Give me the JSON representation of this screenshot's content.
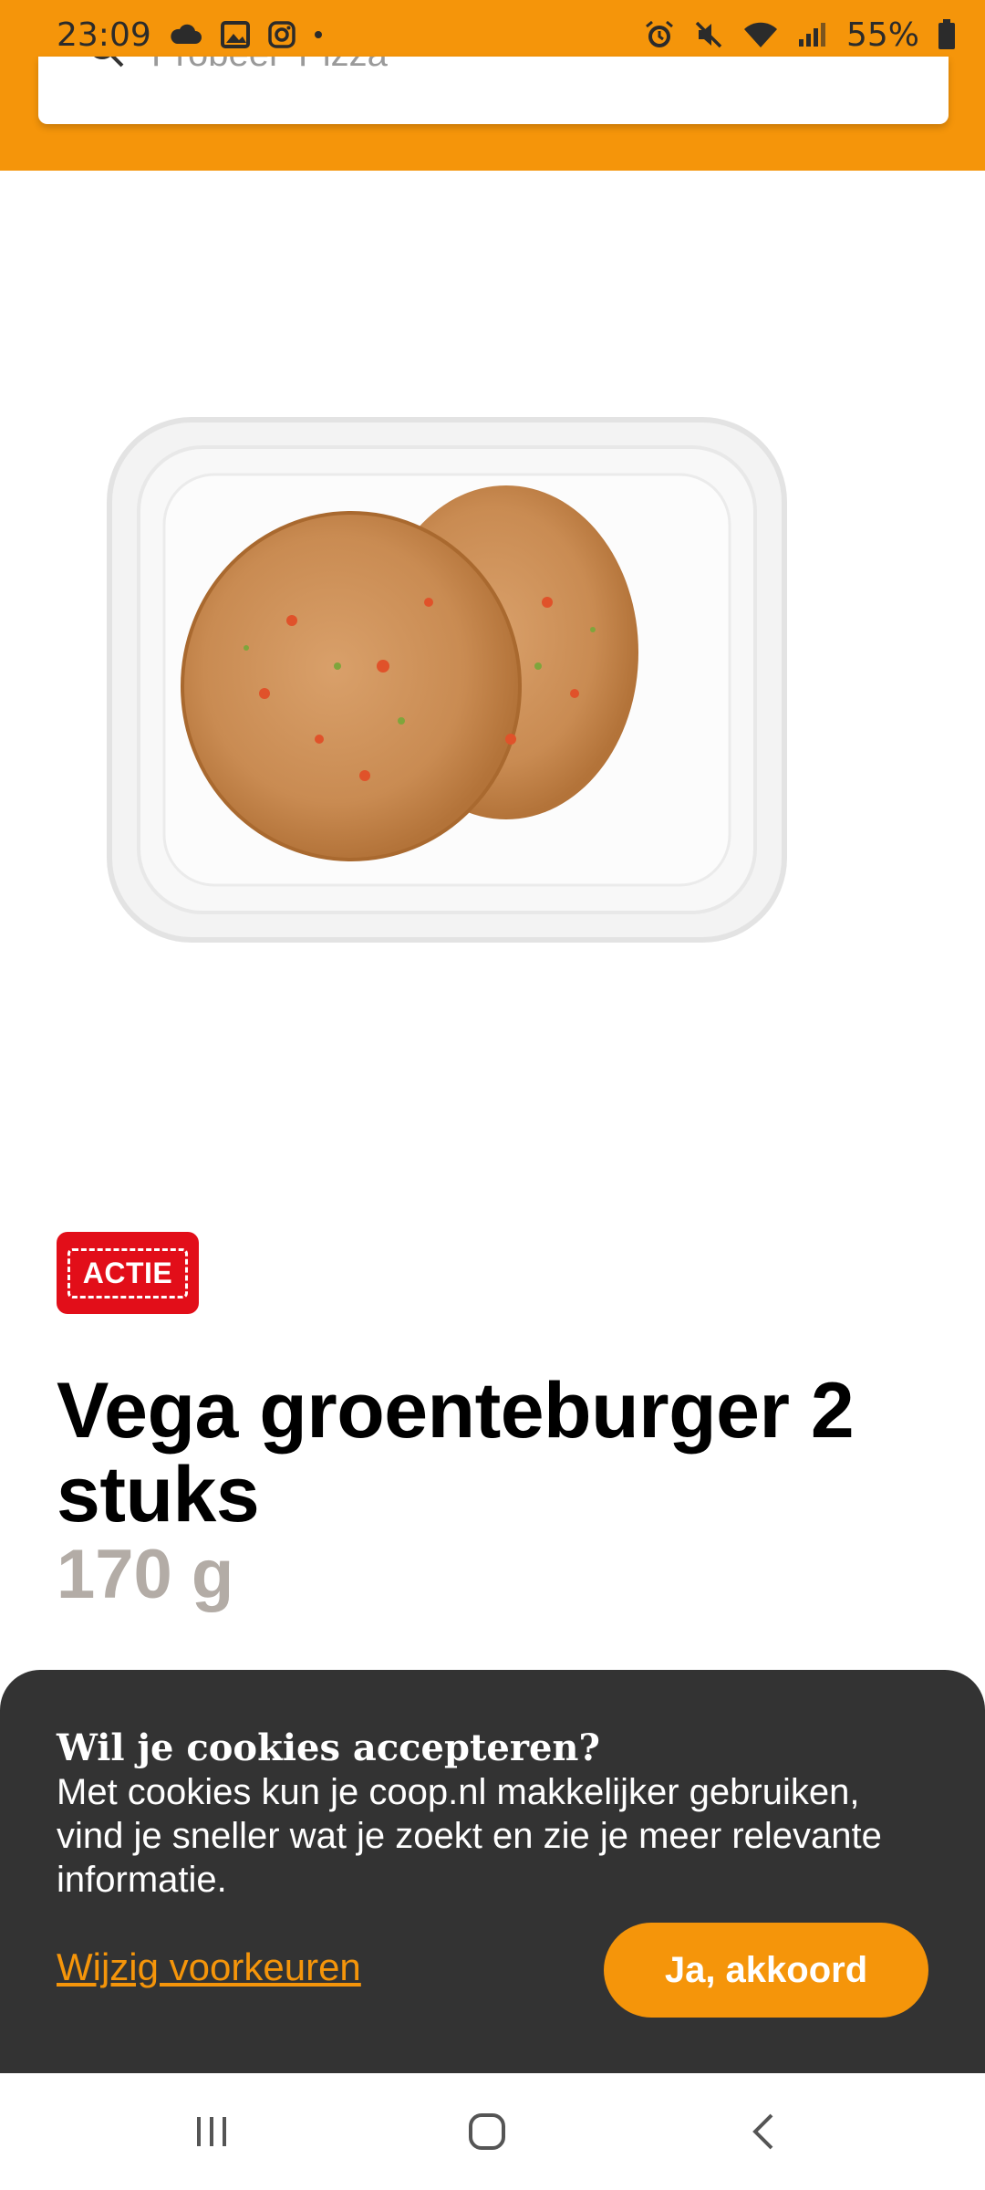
{
  "status_bar": {
    "time": "23:09",
    "battery": "55%",
    "icons_left": [
      "cloud-icon",
      "gallery-icon",
      "instagram-icon",
      "dot-icon"
    ],
    "icons_right": [
      "alarm-icon",
      "mute-icon",
      "wifi-icon",
      "signal-icon",
      "battery-icon"
    ]
  },
  "header": {
    "bg_color": "#F5950A",
    "search_placeholder": "Probeer 'Pizza'"
  },
  "product": {
    "badge": "ACTIE",
    "title": "Vega groenteburger 2 stuks",
    "weight": "170 g"
  },
  "cookie_banner": {
    "title": "Wil je cookies accepteren?",
    "text": "Met cookies kun je coop.nl makkelijker gebruiken, vind je sneller wat je zoekt en zie je meer relevante informatie.",
    "link_label": "Wijzig voorkeuren",
    "accept_label": "Ja, akkoord"
  },
  "navbar": {
    "icons": [
      "recent-apps-icon",
      "home-icon",
      "back-icon"
    ]
  }
}
